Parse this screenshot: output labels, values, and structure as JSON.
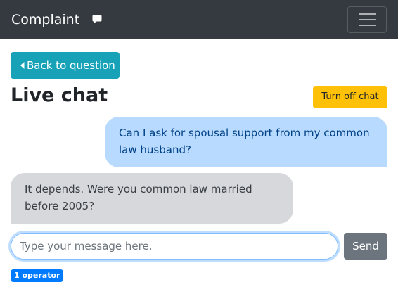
{
  "navbar": {
    "brand": "Complaint",
    "chat_icon": "chat-bubble-icon",
    "menu_icon": "hamburger-menu-icon"
  },
  "back_button": {
    "icon": "caret-left-icon",
    "label": "Back to question"
  },
  "page_title": "Live chat",
  "turn_off_button": {
    "label": "Turn off chat"
  },
  "messages": [
    {
      "sender": "user",
      "text": "Can I ask for spousal support from my common law husband?"
    },
    {
      "sender": "operator",
      "text": "It depends. Were you common law married before 2005?"
    }
  ],
  "composer": {
    "placeholder": "Type your message here.",
    "value": "",
    "send_label": "Send"
  },
  "operator_badge": "1 operator",
  "colors": {
    "navbar_bg": "#343a40",
    "back_button_bg": "#17a2b8",
    "turn_off_bg": "#ffc107",
    "user_bubble_bg": "#b8daff",
    "user_bubble_text": "#004085",
    "operator_bubble_bg": "#d6d8db",
    "send_button_bg": "#6c757d",
    "badge_bg": "#007bff"
  }
}
